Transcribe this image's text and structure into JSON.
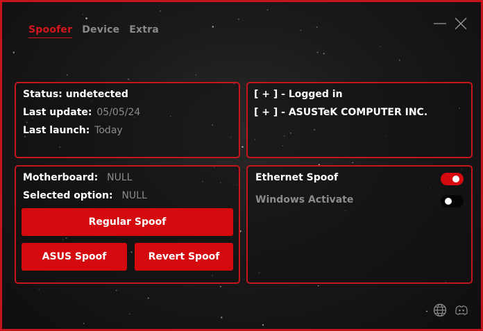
{
  "tabs": [
    {
      "label": "Spoofer",
      "active": true
    },
    {
      "label": "Device",
      "active": false
    },
    {
      "label": "Extra",
      "active": false
    }
  ],
  "status_panel": {
    "status_label": "Status:",
    "status_value": "undetected",
    "last_update_label": "Last update:",
    "last_update_value": "05/05/24",
    "last_launch_label": "Last launch:",
    "last_launch_value": "Today"
  },
  "log_panel": {
    "lines": [
      "[ + ] - Logged in",
      "[ + ] - ASUSTeK COMPUTER INC."
    ]
  },
  "spoof_panel": {
    "motherboard_label": "Motherboard:",
    "motherboard_value": "NULL",
    "selected_label": "Selected option:",
    "selected_value": "NULL",
    "regular_spoof": "Regular Spoof",
    "asus_spoof": "ASUS Spoof",
    "revert_spoof": "Revert Spoof"
  },
  "options_panel": {
    "ethernet_label": "Ethernet Spoof",
    "ethernet_on": true,
    "windows_label": "Windows Activate",
    "windows_on": false
  },
  "icons": {
    "minimize": "minimize-icon",
    "close": "close-icon",
    "globe": "globe-icon",
    "discord": "discord-icon"
  },
  "colors": {
    "accent": "#d40a0f",
    "border": "#c4161c",
    "muted_text": "#8c8c8c"
  }
}
